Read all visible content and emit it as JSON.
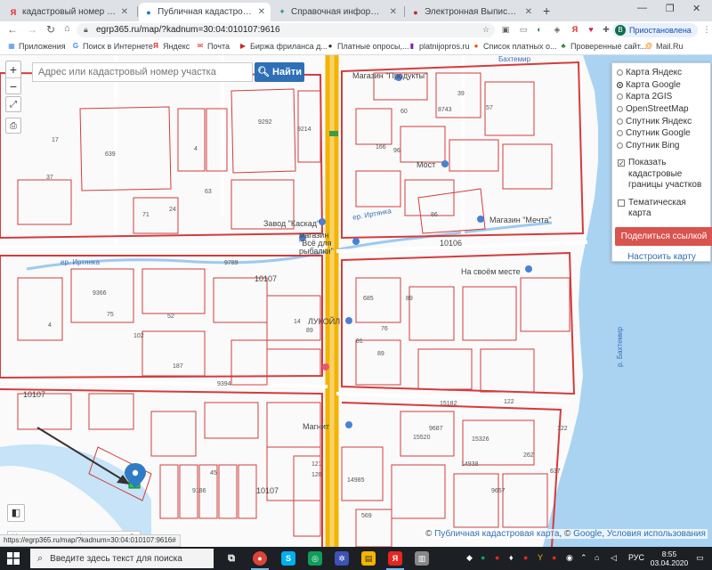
{
  "browser": {
    "tabs": [
      {
        "title": "кадастровый номер по адресу с",
        "favicon": "Я",
        "color": "#e52620"
      },
      {
        "title": "Публичная кадастровая карта",
        "favicon": "●",
        "color": "#1a73e8"
      },
      {
        "title": "Справочная информация по об",
        "favicon": "✦",
        "color": "#2a9d8f"
      },
      {
        "title": "Электронная Выписка из ЕГРН",
        "favicon": "●",
        "color": "#c62828"
      }
    ],
    "url": "egrp365.ru/map/?kadnum=30:04:010107:9616",
    "profile_label": "Приостановлена",
    "profile_initial": "В",
    "bookmarks": [
      {
        "label": "Приложения",
        "icon": "▦",
        "color": "#4285f4"
      },
      {
        "label": "Поиск в Интернете",
        "icon": "G",
        "color": "#4285f4"
      },
      {
        "label": "Яндекс",
        "icon": "Я",
        "color": "#e52620"
      },
      {
        "label": "Почта",
        "icon": "✉",
        "color": "#e52620"
      },
      {
        "label": "Биржа фриланса д...",
        "icon": "▶",
        "color": "#c62828"
      },
      {
        "label": "Платные опросы,...",
        "icon": "●",
        "color": "#333333"
      },
      {
        "label": "platnijopros.ru",
        "icon": "▮",
        "color": "#7b1fa2"
      },
      {
        "label": "Список платных о...",
        "icon": "●",
        "color": "#e65100"
      },
      {
        "label": "Проверенные сайт...",
        "icon": "♣",
        "color": "#2e7d32"
      },
      {
        "label": "Mail.Ru",
        "icon": "@",
        "color": "#f57c00"
      }
    ]
  },
  "map": {
    "search_placeholder": "Адрес или кадастровый номер участка",
    "search_button": "Найти",
    "zoom_in": "+",
    "zoom_out": "−",
    "layers": [
      {
        "label": "Карта Яндекс",
        "selected": false
      },
      {
        "label": "Карта Google",
        "selected": true
      },
      {
        "label": "Карта 2GIS",
        "selected": false
      },
      {
        "label": "OpenStreetMap",
        "selected": false
      },
      {
        "label": "Спутник Яндекс",
        "selected": false
      },
      {
        "label": "Спутник Google",
        "selected": false
      },
      {
        "label": "Спутник Bing",
        "selected": false
      }
    ],
    "show_boundaries_label": "Показать кадастровые границы участков",
    "show_boundaries_checked": true,
    "thematic_label": "Тематическая карта",
    "thematic_checked": false,
    "share_button": "Поделиться ссылкой",
    "configure_link": "Настроить карту",
    "not_found_text": "Не нашли участок/дом на карте?",
    "attribution": {
      "copy1": "©",
      "link1": "Публичная кадастровая карта",
      "copy2": ", ©",
      "link2": "Google",
      "sep": ",",
      "link3": "Условия использования"
    },
    "status_url": "https://egrp365.ru/map/?kadnum=30:04:010107:9616#",
    "place_labels": {
      "shop_products": "Магазин \"Продукты\"",
      "zavod": "Завод \"Каскад\"",
      "shop_all": "магазин \"Всё для рыбалки\"",
      "mechta": "Магазин \"Мечта\"",
      "most": "Мост",
      "irtyanka_1": "ер. Иртянка",
      "irtyanka_2": "ер. Иртянка",
      "na_svoem": "На своём месте",
      "lukoil": "ЛУКОЙЛ",
      "magnit": "Магнит",
      "bakhtemir": "р. Бахтемир",
      "bakhtemir_top": "Бахтемир",
      "q10107a": "10107",
      "q10107b": "10107",
      "q10107c": "10107",
      "q10106": "10106"
    },
    "parcel_labels": [
      "639",
      "9292",
      "9214",
      "60",
      "39",
      "8743",
      "166",
      "96",
      "63",
      "86",
      "9789",
      "9366",
      "75",
      "187",
      "14",
      "89",
      "685",
      "76",
      "89",
      "9394",
      "102",
      "15182",
      "9687",
      "15520",
      "15326",
      "14938",
      "9657",
      "262",
      "637",
      "122",
      "569",
      "9186",
      "45",
      "121",
      "120",
      "14985",
      "122",
      "4",
      "52",
      "17",
      "37",
      "4",
      "24",
      "57",
      "71",
      "81",
      "89"
    ]
  },
  "taskbar": {
    "search_placeholder": "Введите здесь текст для поиска",
    "lang": "РУС",
    "time": "8:55",
    "date": "03.04.2020"
  }
}
